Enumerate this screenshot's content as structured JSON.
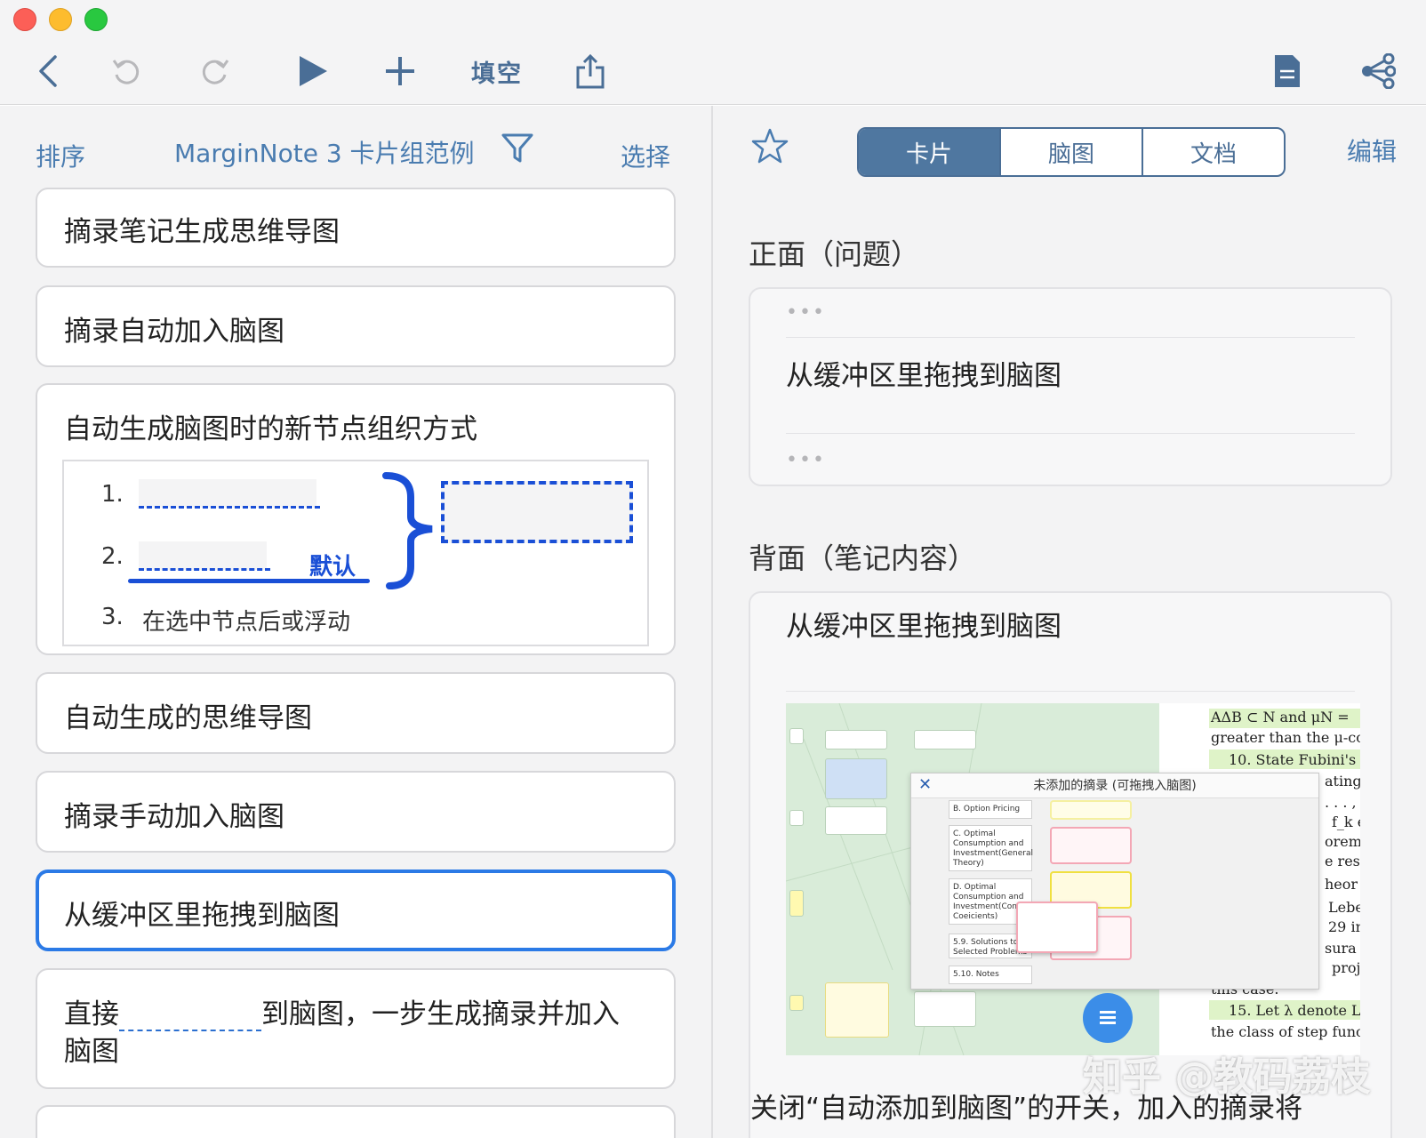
{
  "toolbar": {
    "cloze_label": "填空"
  },
  "left": {
    "sort_label": "排序",
    "title": "MarginNote 3 卡片组范例",
    "select_label": "选择",
    "cards": [
      {
        "text": "摘录笔记生成思维导图"
      },
      {
        "text": "摘录自动加入脑图"
      },
      {
        "text": "自动生成脑图时的新节点组织方式"
      },
      {
        "text": "自动生成的思维导图"
      },
      {
        "text": "摘录手动加入脑图"
      },
      {
        "text": "从缓冲区里拖拽到脑图"
      },
      {
        "text_before": "直接",
        "text_after": "到脑图，一步生成摘录并加入",
        "text_line2": "脑图"
      }
    ],
    "diagram": {
      "n1": "1.",
      "n2": "2.",
      "n3": "3.",
      "default_label": "默认",
      "item3": "在选中节点后或浮动"
    }
  },
  "right": {
    "tabs": [
      "卡片",
      "脑图",
      "文档"
    ],
    "active_tab": 0,
    "edit_label": "编辑",
    "front_heading": "正面（问题）",
    "dots": "•••",
    "front_text": "从缓冲区里拖拽到脑图",
    "back_heading": "背面（笔记内容）",
    "back_title": "从缓冲区里拖拽到脑图",
    "bottom_line1": "关闭“自动添加到脑图”的开关，加入的摘录将",
    "watermark": "知乎 @教码荔枝",
    "screenshot": {
      "dialog_title": "未添加的摘录 (可拖拽入脑图)",
      "list": [
        "B. Option Pricing",
        "C. Optimal Consumption and Investment(General Theory)",
        "D. Optimal Consumption and Investment(Constant Coeicients)",
        "5.9. Solutions to Selected Problems",
        "5.10. Notes"
      ],
      "page_lines": [
        "AΔB ⊂ N and μN =",
        "greater than the μ-co",
        "10. State Fubini's",
        "ating",
        ". . . ,",
        "f_k e",
        "orem",
        "e res",
        "heor",
        "Lebe",
        "29 in",
        "sura",
        "proj",
        "this case.",
        "15. Let λ denote L",
        "the class of step func"
      ]
    }
  },
  "colors": {
    "accent": "#4a7cb0",
    "selected_border": "#2b7ae6",
    "segment_active": "#4f77a0",
    "diagram_blue": "#1a4fd6"
  }
}
